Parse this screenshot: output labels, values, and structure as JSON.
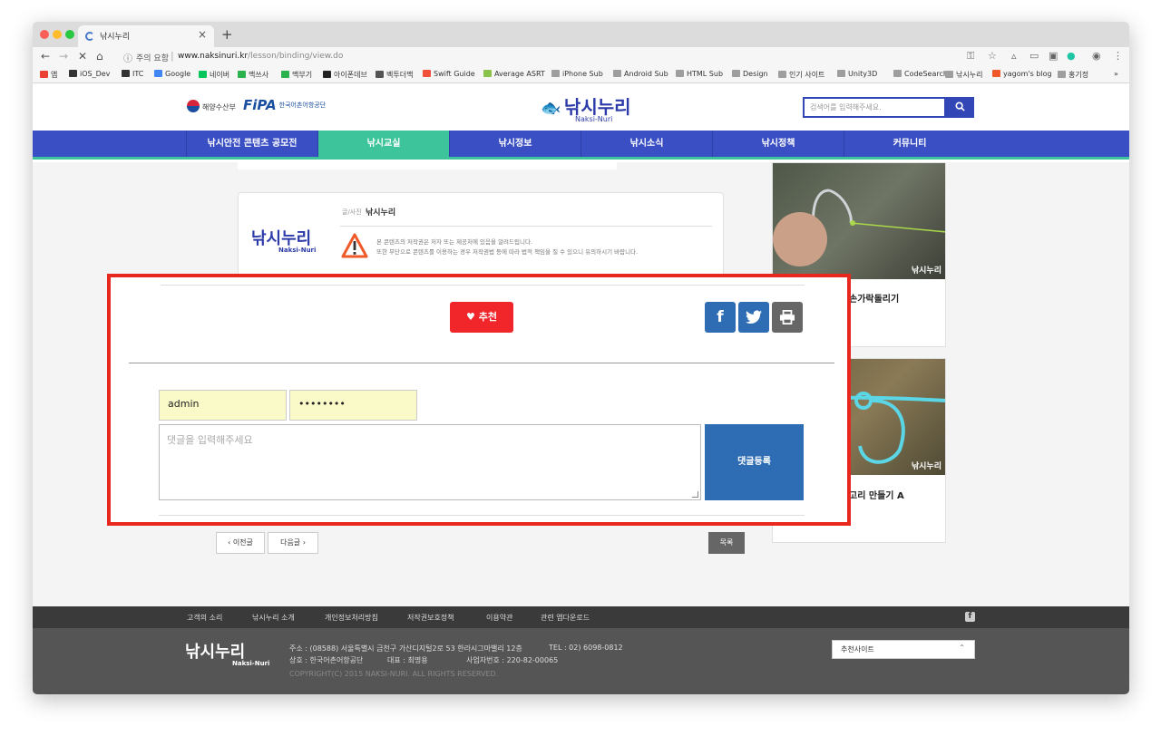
{
  "browser": {
    "tab_title": "낚시누리",
    "tab_close": "×",
    "new_tab": "+",
    "security_label": "주의 요함",
    "url_host": "www.naksinuri.kr",
    "url_path": "/lesson/binding/view.do",
    "bookmarks": [
      {
        "label": "앱",
        "color": "#e94235"
      },
      {
        "label": "iOS_Dev",
        "color": "#333333"
      },
      {
        "label": "ITC",
        "color": "#333333"
      },
      {
        "label": "Google",
        "color": "#4285f4"
      },
      {
        "label": "네이버",
        "color": "#03c75a"
      },
      {
        "label": "맥쓰사",
        "color": "#2bb24c"
      },
      {
        "label": "맥부기",
        "color": "#2bb24c"
      },
      {
        "label": "아이폰데브",
        "color": "#222222"
      },
      {
        "label": "벡투더맥",
        "color": "#555555"
      },
      {
        "label": "Swift Guide",
        "color": "#f05138"
      },
      {
        "label": "Average ASRT",
        "color": "#8bc34a"
      },
      {
        "label": "iPhone Sub",
        "color": "#9e9e9e"
      },
      {
        "label": "Android Sub",
        "color": "#9e9e9e"
      },
      {
        "label": "HTML Sub",
        "color": "#9e9e9e"
      },
      {
        "label": "Design",
        "color": "#9e9e9e"
      },
      {
        "label": "인기 사이트",
        "color": "#9e9e9e"
      },
      {
        "label": "Unity3D",
        "color": "#9e9e9e"
      },
      {
        "label": "CodeSearch",
        "color": "#9e9e9e"
      },
      {
        "label": "낚시누리",
        "color": "#9e9e9e"
      },
      {
        "label": "yagom's blog",
        "color": "#f05a28"
      },
      {
        "label": "홍기정",
        "color": "#9e9e9e"
      }
    ],
    "bookmarks_more": "»"
  },
  "header": {
    "gov_logo_text": "해양수산부",
    "fipa_logo_text": "FiPA",
    "fipa_sub_text": "한국어촌어항공단",
    "site_logo_text": "낚시누리",
    "site_logo_sub": "Naksi-Nuri",
    "search_placeholder": "검색어를 입력해주세요.",
    "search_icon": "magnifier-icon"
  },
  "nav": {
    "items": [
      {
        "label": "낚시안전 콘텐츠 공모전",
        "active": false
      },
      {
        "label": "낚시교실",
        "active": true
      },
      {
        "label": "낚시정보",
        "active": false
      },
      {
        "label": "낚시소식",
        "active": false
      },
      {
        "label": "낚시정책",
        "active": false
      },
      {
        "label": "커뮤니티",
        "active": false
      }
    ],
    "accent_color": "#3dc49a",
    "bar_color": "#3a4fc4"
  },
  "article": {
    "author_label": "글/사진",
    "author_name": "낚시누리",
    "author_logo_text": "낚시누리",
    "author_logo_sub": "Naksi-Nuri",
    "notice_line1": "본 콘텐츠의 저작권은 저자 또는 제공처에 있음을 알려드립니다.",
    "notice_line2": "또한 무단으로 콘텐츠를 이용하는 경우 저작권법 등에 따라 법적 책임을 질 수 있으니 유의하시기 바랍니다.",
    "recommend_label": "추천",
    "share_facebook": "f",
    "share_twitter": "twitter-icon",
    "share_print": "print-icon",
    "prev_label": "‹ 이전글",
    "next_label": "다음글 ›",
    "list_label": "목록"
  },
  "comment": {
    "user_value": "admin",
    "password_value": "••••••••",
    "textarea_placeholder": "댓글을 입력해주세요",
    "submit_label": "댓글등록"
  },
  "sidebar": {
    "cards": [
      {
        "title": "손가락돌리기",
        "watermark": "낚시누리"
      },
      {
        "title": "고리 만들기 A",
        "watermark": "낚시누리"
      }
    ]
  },
  "footer": {
    "links": [
      "고객의 소리",
      "낚시누리 소개",
      "개인정보처리방침",
      "저작권보호정책",
      "이용약관",
      "관련 앱다운로드"
    ],
    "logo_text": "낚시누리",
    "logo_sub": "Naksi-Nuri",
    "address": "주소 : (08588) 서울특별시 금천구 가산디지털2로 53 한라시그마밸리 12층",
    "tel": "TEL : 02) 6098-0812",
    "company": "상호 : 한국어촌어항공단",
    "ceo": "대표 : 최명용",
    "biz_no": "사업자번호 : 220-82-00065",
    "copyright": "COPYRIGHT(C) 2015 NAKSI-NURI. ALL RIGHTS RESERVED.",
    "recommend_site_label": "추천사이트",
    "recommend_site_chevron": "⌃"
  },
  "annotation_color": "#e8281e"
}
